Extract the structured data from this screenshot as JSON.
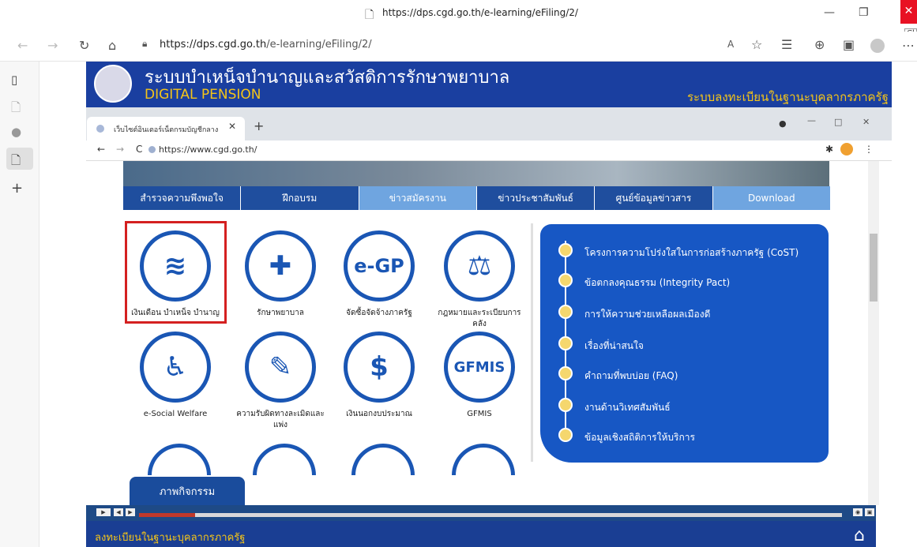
{
  "outer_browser": {
    "title": "https://dps.cgd.go.th/e-learning/eFiling/2/",
    "url_host": "https://dps.cgd.go.th",
    "url_path": "/e-learning/eFiling/2/",
    "tooltip": "Cl"
  },
  "banner": {
    "thai_title": "ระบบบำเหน็จบำนาญและสวัสดิการรักษาพยาบาล",
    "english_title": "DIGITAL PENSION",
    "right_label": "ระบบลงทะเบียนในฐานะบุคลากรภาครัฐ"
  },
  "inner_browser": {
    "tab_title": "เว็บไซต์อินเตอร์เน็ตกรมบัญชีกลาง",
    "url": "https://www.cgd.go.th/"
  },
  "menu": [
    "สำรวจความพึงพอใจ",
    "ฝึกอบรม",
    "ข่าวสมัครงาน",
    "ข่าวประชาสัมพันธ์",
    "ศูนย์ข้อมูลข่าวสาร",
    "Download"
  ],
  "icons": [
    {
      "label": "เงินเดือน บำเหน็จ บำนาญ",
      "glyph": "≋",
      "name": "pension-icon"
    },
    {
      "label": "รักษาพยาบาล",
      "glyph": "✚",
      "name": "medical-icon"
    },
    {
      "label": "จัดซื้อจัดจ้างภาครัฐ",
      "glyph": "e-GP",
      "name": "egp-icon"
    },
    {
      "label": "กฎหมายและระเบียบการคลัง",
      "glyph": "⚖",
      "name": "law-scale-icon"
    },
    {
      "label": "e-Social Welfare",
      "glyph": "♿",
      "name": "welfare-icon"
    },
    {
      "label": "ความรับผิดทางละเมิดและแพ่ง",
      "glyph": "✎",
      "name": "law-book-icon"
    },
    {
      "label": "เงินนอกงบประมาณ",
      "glyph": "$",
      "name": "budget-icon"
    },
    {
      "label": "GFMIS",
      "glyph": "GFMIS",
      "name": "gfmis-icon"
    }
  ],
  "info_items": [
    "โครงการความโปร่งใสในการก่อสร้างภาครัฐ (CoST)",
    "ข้อตกลงคุณธรรม (Integrity Pact)",
    "การให้ความช่วยเหลือผลเมืองดี",
    "เรื่องที่น่าสนใจ",
    "คำถามที่พบบ่อย (FAQ)",
    "งานด้านวิเทศสัมพันธ์",
    "ข้อมูลเชิงสถิติการให้บริการ"
  ],
  "activity_tab": "ภาพกิจกรรม",
  "footer_text": "ลงทะเบียนในฐานะบุคลากรภาครัฐ",
  "player_progress": 0.08
}
